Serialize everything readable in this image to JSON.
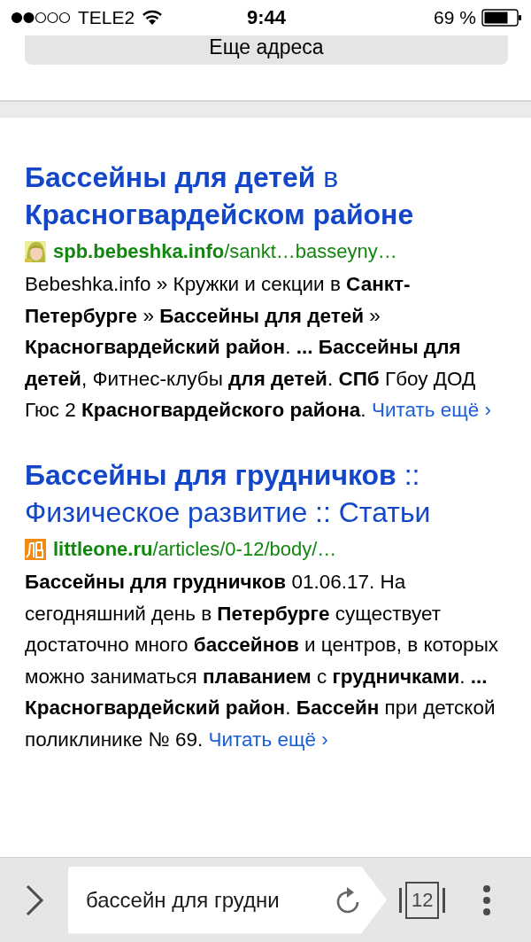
{
  "status_bar": {
    "carrier": "TELE2",
    "time": "9:44",
    "battery": "69 %"
  },
  "more_addresses_button": "Еще адреса",
  "results": [
    {
      "title": "**Бассейны для детей** в **Красногвардейском районе**",
      "domain": "spb.bebeshka.info",
      "path": "/sankt…basseyny…",
      "snippet": "Bebeshka.info » Кружки и секции в **Санкт-Петербурге** » **Бассейны для детей** » **Красногвардейский район**. **...** **Бассейны для детей**, Фитнес-клубы **для детей**. **СПб** Гбоу ДОД Гюс 2 **Красногвардейского района**.",
      "read_more": "Читать ещё ›"
    },
    {
      "title": "**Бассейны для грудничков** :: Физическое развитие :: Статьи",
      "favicon": {
        "kind": "logo"
      },
      "domain": "littleone.ru",
      "path": "/articles/0-12/body/…",
      "snippet": "**Бассейны для грудничков** 01.06.17. На сегодняшний день в **Петербурге** существует достаточно много **бассейнов** и центров, в которых можно заниматься **плаванием** с **грудничками**. **...** **Красногвардейский район**. **Бассейн** при детской поликлинике № 69.",
      "read_more": "Читать ещё ›"
    }
  ],
  "toolbar": {
    "query": "бассейн для грудни",
    "tab_count": "12"
  }
}
